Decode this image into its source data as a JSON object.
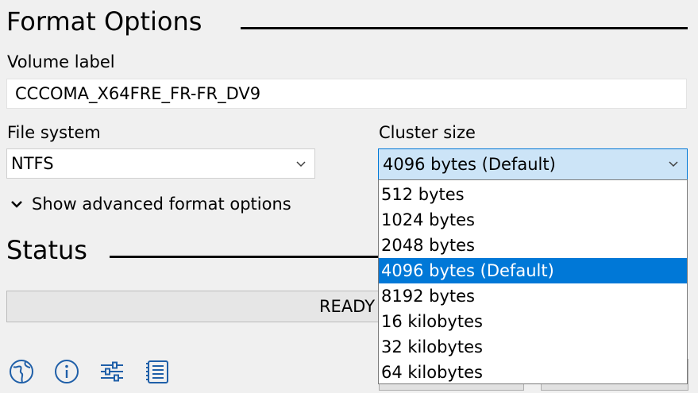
{
  "format_options": {
    "title": "Format Options",
    "volume_label": {
      "label": "Volume label",
      "value": "CCCOMA_X64FRE_FR-FR_DV9"
    },
    "file_system": {
      "label": "File system",
      "value": "NTFS"
    },
    "cluster_size": {
      "label": "Cluster size",
      "value": "4096 bytes (Default)",
      "options": [
        "512 bytes",
        "1024 bytes",
        "2048 bytes",
        "4096 bytes (Default)",
        "8192 bytes",
        "16 kilobytes",
        "32 kilobytes",
        "64 kilobytes"
      ],
      "selected_index": 3
    },
    "advanced_toggle": "Show advanced format options"
  },
  "status": {
    "title": "Status",
    "progress_text": "READY"
  },
  "toolbar_icons": [
    "globe-icon",
    "info-icon",
    "settings-sliders-icon",
    "log-icon"
  ],
  "colors": {
    "background": "#f0f0f0",
    "accent": "#0078d7",
    "combo_open": "#cce4f7"
  }
}
